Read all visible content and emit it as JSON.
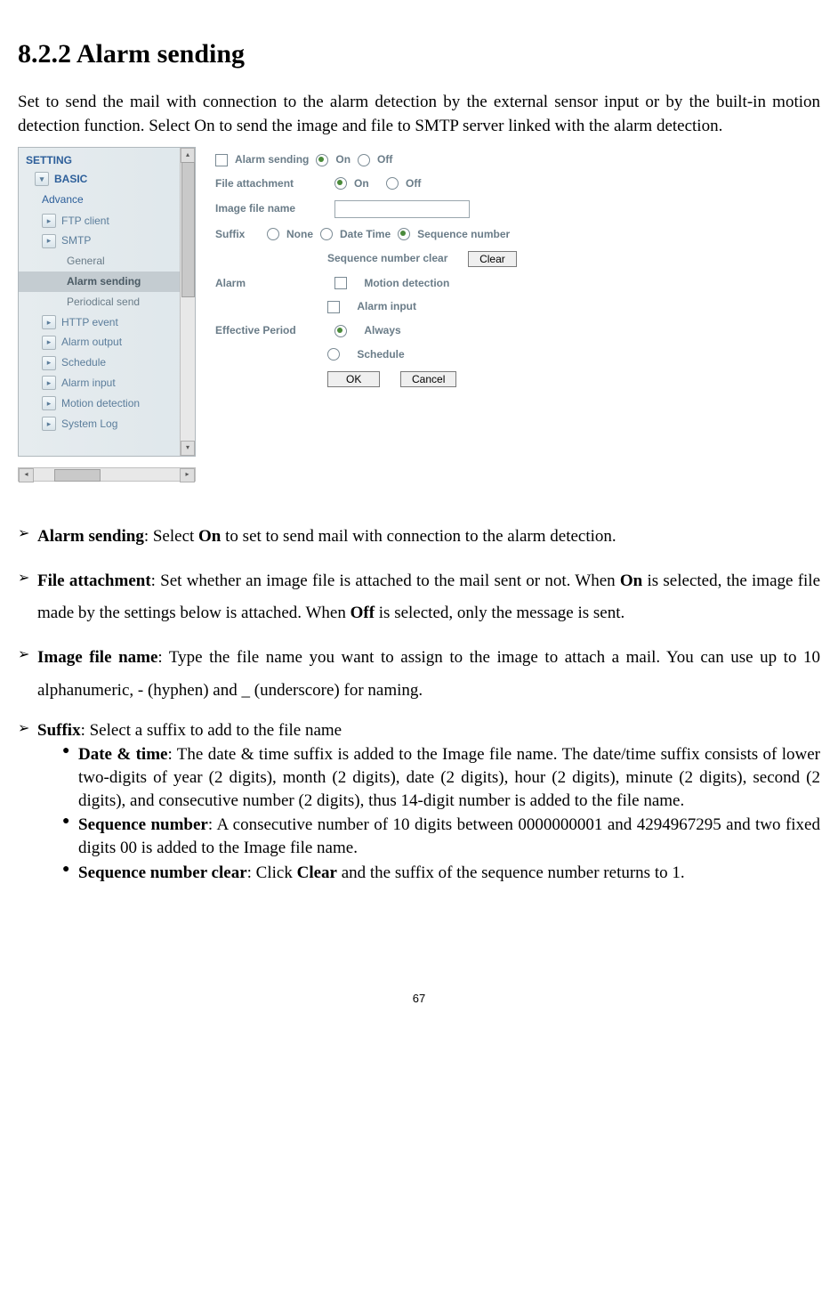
{
  "heading": "8.2.2 Alarm sending",
  "intro": "Set to send the mail with connection to the alarm detection by the external sensor input or by the built-in motion detection function. Select On to send the image and file to SMTP server linked with the alarm detection.",
  "sidebar": {
    "setting": "SETTING",
    "basic": "BASIC",
    "advance": "Advance",
    "items": {
      "ftp": "FTP client",
      "smtp": "SMTP",
      "general": "General",
      "alarm_sending": "Alarm sending",
      "periodical": "Periodical send",
      "http_event": "HTTP event",
      "alarm_output": "Alarm output",
      "schedule": "Schedule",
      "alarm_input": "Alarm input",
      "motion": "Motion detection",
      "syslog": "System Log"
    }
  },
  "panel": {
    "alarm_sending": "Alarm sending",
    "on": "On",
    "off": "Off",
    "file_attachment": "File attachment",
    "image_file_name": "Image file name",
    "suffix": "Suffix",
    "none": "None",
    "date_time": "Date Time",
    "sequence_number": "Sequence number",
    "seq_clear_label": "Sequence number clear",
    "clear": "Clear",
    "alarm": "Alarm",
    "motion_detection": "Motion detection",
    "alarm_input": "Alarm input",
    "effective_period": "Effective Period",
    "always": "Always",
    "schedule": "Schedule",
    "ok": "OK",
    "cancel": "Cancel"
  },
  "desc": {
    "d1a": "Alarm sending",
    "d1b": ": Select ",
    "d1c": "On",
    "d1d": " to set to send mail with connection to the alarm detection.",
    "d2a": "File attachment",
    "d2b": ": Set whether an image file is attached to the mail sent or not. When ",
    "d2c": "On",
    "d2d": " is selected, the image file made by the settings below is attached. When ",
    "d2e": "Off",
    "d2f": " is selected, only the message is sent.",
    "d3a": "Image file name",
    "d3b": ": Type the file name you want to assign to the image to attach a mail. You can use up to 10 alphanumeric, - (hyphen) and _ (underscore) for naming.",
    "d4a": "Suffix",
    "d4b": ": Select a suffix to add to the file name",
    "s1a": "Date & time",
    "s1b": ": The date & time suffix is added to the Image file name. The date/time suffix consists of lower two-digits of year (2 digits), month (2 digits), date (2 digits), hour (2 digits), minute (2 digits), second (2 digits), and consecutive number (2 digits), thus 14-digit number is added to the file name.",
    "s2a": "Sequence number",
    "s2b": ": A consecutive number of 10 digits between 0000000001 and 4294967295 and two fixed digits 00 is added to the Image file name.",
    "s3a": "Sequence number clear",
    "s3b": ": Click ",
    "s3c": "Clear",
    "s3d": " and the suffix of the sequence number returns to 1."
  },
  "page_number": "67"
}
